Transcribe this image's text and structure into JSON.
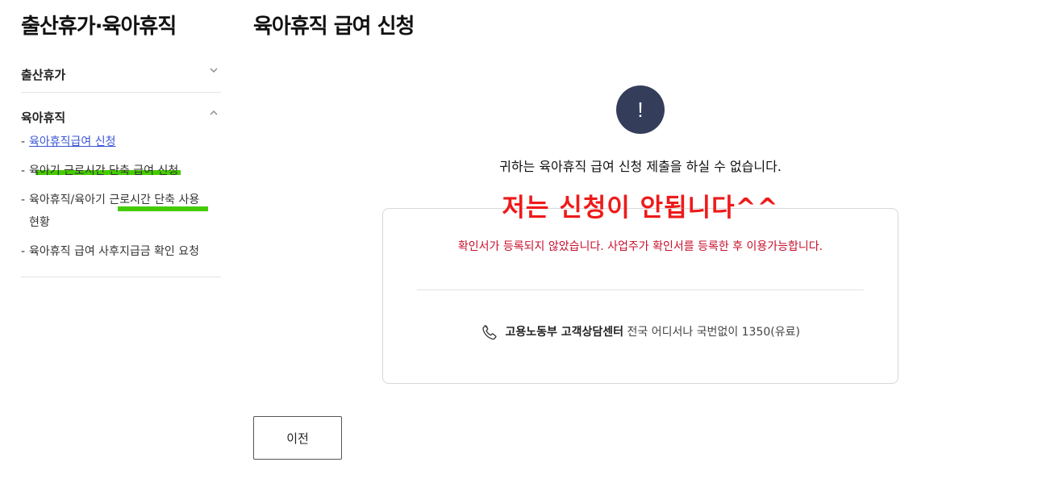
{
  "sidebar": {
    "title": "출산휴가·육아휴직",
    "sections": [
      {
        "label": "출산휴가",
        "expanded": false
      },
      {
        "label": "육아휴직",
        "expanded": true
      }
    ],
    "items": [
      {
        "label": "육아휴직급여 신청",
        "active": true
      },
      {
        "label": "육아기 근로시간 단축 급여 신청"
      },
      {
        "label": "육아휴직/육아기 근로시간 단축 사용"
      },
      {
        "label": "현황"
      },
      {
        "label": "육아휴직 급여 사후지급금 확인 요청"
      }
    ],
    "dash": "-"
  },
  "main": {
    "title": "육아휴직 급여 신청",
    "alert_symbol": "!",
    "message": "귀하는 육아휴직 급여 신청 제출을 하실 수 없습니다.",
    "annotation": "저는 신청이 안됩니다^^",
    "error_text": "확인서가 등록되지 않았습니다. 사업주가 확인서를 등록한 후 이용가능합니다.",
    "contact_name": "고용노동부 고객상담센터",
    "contact_detail": "전국 어디서나 국번없이 1350(유료)",
    "prev_button": "이전"
  },
  "colors": {
    "alert_bg": "#343e5b",
    "error": "#c8102e",
    "annotation": "#ee1a1a",
    "highlight": "#44cc00",
    "link": "#3a56d4"
  },
  "icons": [
    "chevron-down-icon",
    "chevron-up-icon",
    "alert-icon",
    "phone-icon"
  ]
}
